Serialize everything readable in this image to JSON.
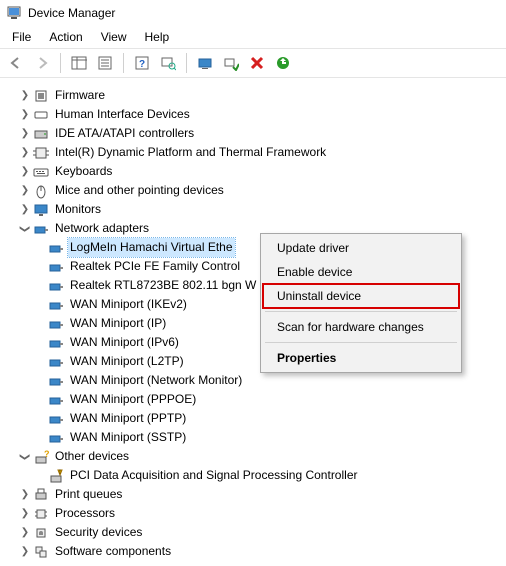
{
  "window": {
    "title": "Device Manager"
  },
  "menu": {
    "file": "File",
    "action": "Action",
    "view": "View",
    "help": "Help"
  },
  "tree": {
    "firmware": "Firmware",
    "hid": "Human Interface Devices",
    "ide": "IDE ATA/ATAPI controllers",
    "intel_dptf": "Intel(R) Dynamic Platform and Thermal Framework",
    "keyboards": "Keyboards",
    "mice": "Mice and other pointing devices",
    "monitors": "Monitors",
    "network_adapters": "Network adapters",
    "na_items": [
      "LogMeIn Hamachi Virtual Ethe",
      "Realtek PCIe FE Family Control",
      "Realtek RTL8723BE 802.11 bgn W",
      "WAN Miniport (IKEv2)",
      "WAN Miniport (IP)",
      "WAN Miniport (IPv6)",
      "WAN Miniport (L2TP)",
      "WAN Miniport (Network Monitor)",
      "WAN Miniport (PPPOE)",
      "WAN Miniport (PPTP)",
      "WAN Miniport (SSTP)"
    ],
    "other_devices": "Other devices",
    "od_item": "PCI Data Acquisition and Signal Processing Controller",
    "print_queues": "Print queues",
    "processors": "Processors",
    "security": "Security devices",
    "software": "Software components"
  },
  "context_menu": {
    "update": "Update driver",
    "enable": "Enable device",
    "uninstall": "Uninstall device",
    "scan": "Scan for hardware changes",
    "properties": "Properties"
  }
}
